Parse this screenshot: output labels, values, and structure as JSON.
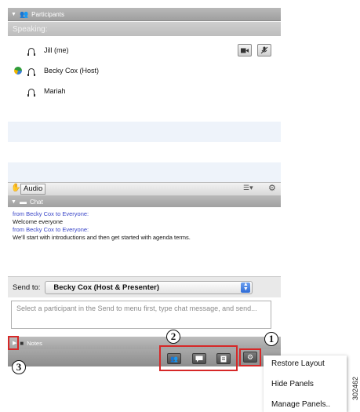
{
  "participants_panel": {
    "title": "Participants",
    "speaking_label": "Speaking:",
    "participants": [
      {
        "name": "Jill (me)"
      },
      {
        "name": "Becky Cox (Host)"
      },
      {
        "name": "Mariah"
      }
    ]
  },
  "audio_bar": {
    "audio_label": "Audio"
  },
  "chat_panel": {
    "title": "Chat",
    "messages": [
      {
        "from": "from Becky Cox to Everyone:",
        "text": "Welcome everyone"
      },
      {
        "from": "from Becky Cox to Everyone:",
        "text": "We'll start with introductions and then get started with agenda terms."
      }
    ],
    "send_to_label": "Send to:",
    "send_to_value": "Becky Cox (Host & Presenter)",
    "message_placeholder": "Select a participant in the Send to menu first, type chat message, and send..."
  },
  "notes_panel": {
    "title": "Notes"
  },
  "callouts": {
    "one": "1",
    "two": "2",
    "three": "3"
  },
  "context_menu": {
    "items": [
      "Restore Layout",
      "Hide Panels",
      "Manage Panels.."
    ]
  },
  "figure_id": "302462",
  "colors": {
    "red_highlight": "#d62828",
    "chat_sender_blue": "#3a46c8",
    "select_arrow_blue": "#2e6bd6"
  }
}
